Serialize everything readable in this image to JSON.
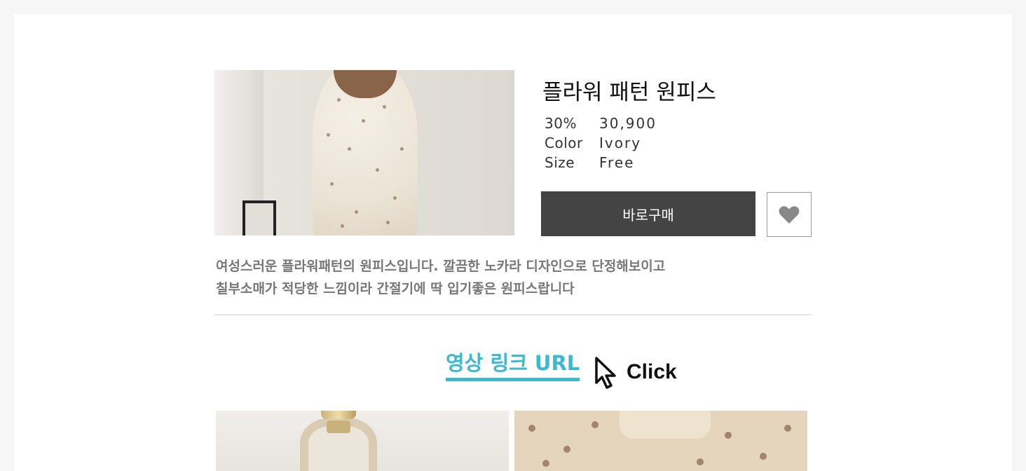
{
  "product": {
    "title": "플라워 패턴 원피스",
    "specs": [
      {
        "label": "30%",
        "value": "30,900"
      },
      {
        "label": "Color",
        "value": "Ivory"
      },
      {
        "label": "Size",
        "value": "Free"
      }
    ],
    "buy_label": "바로구매",
    "wishlist_icon": "heart-icon",
    "description": [
      "여성스러운 플라워패턴의 원피스입니다. 깔끔한 노카라 디자인으로 단정해보이고",
      "칠부소매가 적당한 느낌이라 간절기에 딱 입기좋은 원피스랍니다"
    ]
  },
  "video": {
    "link_text": "영상 링크 URL",
    "link_color": "#3db9cd",
    "cursor_icon": "mouse-pointer-icon",
    "click_text": "Click"
  },
  "colors": {
    "background": "#f6f6f6",
    "buy_button": "#444444",
    "heart": "#888888"
  }
}
